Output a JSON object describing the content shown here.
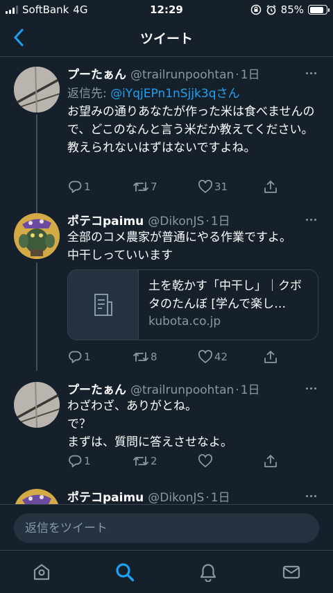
{
  "status_bar": {
    "carrier": "SoftBank",
    "network": "4G",
    "time": "12:29",
    "battery": "85%",
    "battery_level": 0.85,
    "icons": [
      "signal-icon",
      "orientation-lock-icon",
      "alarm-icon",
      "battery-icon"
    ]
  },
  "nav": {
    "title": "ツイート",
    "back_icon": "chevron-left-icon"
  },
  "tweets": [
    {
      "display_name": "プーたぁん",
      "handle": "@trailrunpoohtan",
      "time": "1日",
      "reply_prefix": "返信先: ",
      "reply_mention": "@iYqjEPn1nSjjk3q",
      "reply_suffix": "さん",
      "text": "お望みの通りあなたが作った米は食べませんので、どこのなんと言う米だか教えてください。\n教えられないはずはないですよね。",
      "replies": "1",
      "retweets": "7",
      "likes": "31"
    },
    {
      "display_name": "ポテコpaimu",
      "handle": "@DikonJS",
      "time": "1日",
      "text": "全部のコメ農家が普通にやる作業ですよ。\n中干しっていいます",
      "card": {
        "title": "土を乾かす「中干し」｜クボタのたんぼ [学んで楽し…",
        "domain": "kubota.co.jp"
      },
      "replies": "1",
      "retweets": "8",
      "likes": "42"
    },
    {
      "display_name": "プーたぁん",
      "handle": "@trailrunpoohtan",
      "time": "1日",
      "text": "わざわざ、ありがとね。\nで？\nまずは、質問に答えさせなよ。",
      "replies": "1",
      "retweets": "2",
      "likes": ""
    },
    {
      "display_name": "ポテコpaimu",
      "handle": "@DikonJS",
      "time": "1日"
    }
  ],
  "composer": {
    "placeholder": "返信をツイート"
  },
  "tabs": [
    "home-icon",
    "search-icon",
    "notifications-icon",
    "messages-icon"
  ],
  "colors": {
    "background": "#15202b",
    "accent": "#1da1f2",
    "secondary_text": "#8899a6",
    "border": "#38444d"
  }
}
